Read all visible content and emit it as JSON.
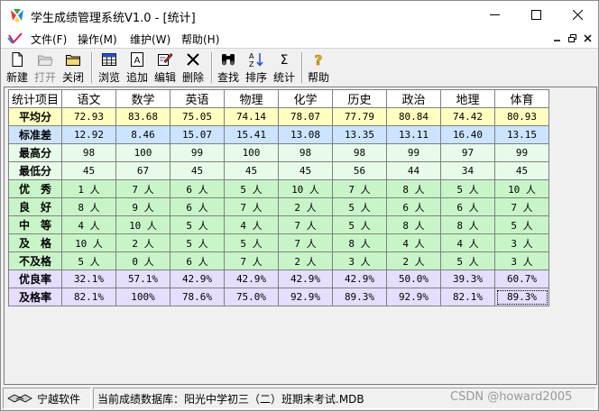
{
  "window": {
    "title": "学生成绩管理系统V1.0 - [统计]"
  },
  "menu": [
    {
      "label": "文件(F)"
    },
    {
      "label": "操作(M)"
    },
    {
      "label": "维护(W)"
    },
    {
      "label": "帮助(H)"
    }
  ],
  "toolbar": {
    "new": "新建",
    "open": "打开",
    "close": "关闭",
    "browse": "浏览",
    "add": "追加",
    "edit": "编辑",
    "delete": "删除",
    "find": "查找",
    "sort": "排序",
    "stats": "统计",
    "help": "帮助"
  },
  "table": {
    "corner": "统计项目",
    "subjects": [
      "语文",
      "数学",
      "英语",
      "物理",
      "化学",
      "历史",
      "政治",
      "地理",
      "体育"
    ],
    "rows": [
      {
        "label": "平均分",
        "values": [
          "72.93",
          "83.68",
          "75.05",
          "74.14",
          "78.07",
          "77.79",
          "80.84",
          "74.42",
          "80.93"
        ]
      },
      {
        "label": "标准差",
        "values": [
          "12.92",
          "8.46",
          "15.07",
          "15.41",
          "13.08",
          "13.35",
          "13.11",
          "16.40",
          "13.15"
        ]
      },
      {
        "label": "最高分",
        "values": [
          "98",
          "100",
          "99",
          "100",
          "98",
          "98",
          "99",
          "97",
          "99"
        ]
      },
      {
        "label": "最低分",
        "values": [
          "45",
          "67",
          "45",
          "45",
          "45",
          "56",
          "44",
          "34",
          "45"
        ]
      },
      {
        "label": "优　秀",
        "values": [
          "1 人",
          "7 人",
          "6 人",
          "5 人",
          "10 人",
          "7 人",
          "8 人",
          "5 人",
          "10 人"
        ]
      },
      {
        "label": "良　好",
        "values": [
          "8 人",
          "9 人",
          "6 人",
          "7 人",
          "2 人",
          "5 人",
          "6 人",
          "6 人",
          "7 人"
        ]
      },
      {
        "label": "中　等",
        "values": [
          "4 人",
          "10 人",
          "5 人",
          "4 人",
          "7 人",
          "5 人",
          "8 人",
          "8 人",
          "5 人"
        ]
      },
      {
        "label": "及　格",
        "values": [
          "10 人",
          "2 人",
          "5 人",
          "5 人",
          "7 人",
          "8 人",
          "4 人",
          "4 人",
          "3 人"
        ]
      },
      {
        "label": "不及格",
        "values": [
          "5 人",
          "0 人",
          "6 人",
          "7 人",
          "2 人",
          "3 人",
          "2 人",
          "5 人",
          "3 人"
        ]
      },
      {
        "label": "优良率",
        "values": [
          "32.1%",
          "57.1%",
          "42.9%",
          "42.9%",
          "42.9%",
          "42.9%",
          "50.0%",
          "39.3%",
          "60.7%"
        ]
      },
      {
        "label": "及格率",
        "values": [
          "82.1%",
          "100%",
          "78.6%",
          "75.0%",
          "92.9%",
          "89.3%",
          "92.9%",
          "82.1%",
          "89.3%"
        ]
      }
    ]
  },
  "status": {
    "company": "宁越软件",
    "database": "当前成绩数据库：阳光中学初三（二）班期末考试.MDB"
  },
  "watermark": "CSDN @howard2005"
}
